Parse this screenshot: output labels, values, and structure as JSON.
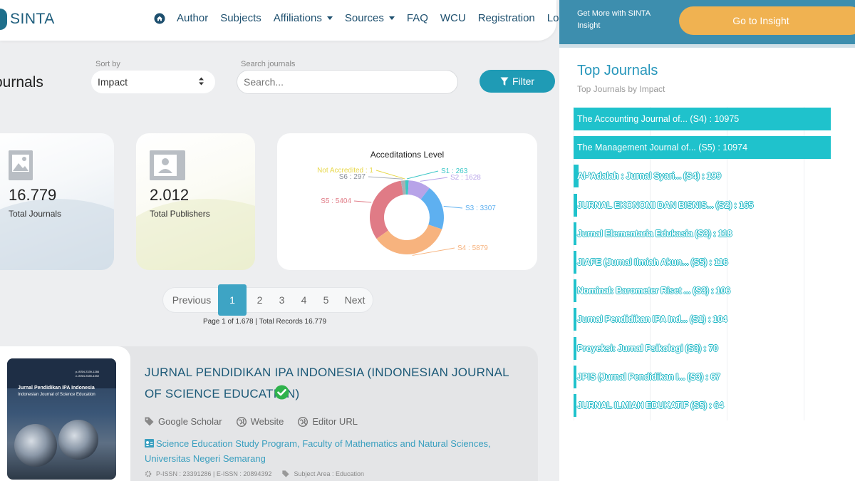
{
  "brand": {
    "name": "SINTA"
  },
  "nav": [
    {
      "label": "Author",
      "dropdown": false
    },
    {
      "label": "Subjects",
      "dropdown": false
    },
    {
      "label": "Affiliations",
      "dropdown": true
    },
    {
      "label": "Sources",
      "dropdown": true
    },
    {
      "label": "FAQ",
      "dropdown": false
    },
    {
      "label": "WCU",
      "dropdown": false
    },
    {
      "label": "Registration",
      "dropdown": false
    },
    {
      "label": "Login",
      "dropdown": false
    }
  ],
  "page": {
    "title": "ournals"
  },
  "sort": {
    "label": "Sort by",
    "value": "Impact"
  },
  "search": {
    "label": "Search journals",
    "placeholder": "Search..."
  },
  "filter": {
    "label": "Filter"
  },
  "stats": [
    {
      "value": "16.779",
      "label": "Total Journals",
      "icon": "image-icon"
    },
    {
      "value": "2.012",
      "label": "Total Publishers",
      "icon": "contact-card-icon"
    }
  ],
  "accreditation_chart": {
    "title": "Acceditations Level",
    "chart_data": {
      "type": "pie",
      "title": "Acceditations Level",
      "slices": [
        {
          "label": "S1",
          "value": 263,
          "color": "#3cc7c7"
        },
        {
          "label": "S2",
          "value": 1628,
          "color": "#b7a3e8"
        },
        {
          "label": "S3",
          "value": 3307,
          "color": "#5eb0f0"
        },
        {
          "label": "S4",
          "value": 5879,
          "color": "#f7b37e"
        },
        {
          "label": "S5",
          "value": 5404,
          "color": "#e07b86"
        },
        {
          "label": "S6",
          "value": 297,
          "color": "#a8aeb6"
        },
        {
          "label": "Not Accredited",
          "value": 1,
          "color": "#e8d84a"
        }
      ]
    }
  },
  "pagination": {
    "previous": "Previous",
    "pages": [
      "1",
      "2",
      "3",
      "4",
      "5"
    ],
    "active": "1",
    "next": "Next",
    "info": "Page 1 of 1.678 | Total Records 16.779"
  },
  "journal": {
    "cover_title": "Jurnal Pendidikan IPA Indonesia",
    "cover_subtitle": "Indonesian Journal of Science Education",
    "cover_issn": "p-ISSN 2339-1286\ne-ISSN 2089-4392",
    "title": "JURNAL PENDIDIKAN IPA INDONESIA (INDONESIAN JOURNAL OF SCIENCE EDUCATION)",
    "links": [
      "Google Scholar",
      "Website",
      "Editor URL"
    ],
    "affiliation": "Science Education Study Program, Faculty of Mathematics and Natural Sciences, Universitas Negeri Semarang",
    "issn": "P-ISSN : 23391286 | E-ISSN : 20894392",
    "subject": "Subject Area : Education"
  },
  "insight": {
    "text": "Get More with SINTA Insight",
    "button": "Go to Insight"
  },
  "top_journals": {
    "title": "Top Journals",
    "subtitle": "Top Journals by Impact",
    "chart_data": {
      "type": "bar",
      "orientation": "horizontal",
      "items": [
        {
          "label": "The Accounting Journal of... (S4) : 10975",
          "value": 10975
        },
        {
          "label": "The Management Journal of... (S5) : 10974",
          "value": 10974
        },
        {
          "label": "Al-'Adalah : Jurnal Syari... (S4) : 199",
          "value": 199
        },
        {
          "label": "JURNAL EKONOMI DAN BISNIS... (S2) : 165",
          "value": 165
        },
        {
          "label": "Jurnal Elementaria Edukasia (S3) : 118",
          "value": 118
        },
        {
          "label": "JIAFE (Jurnal Ilmiah Akun... (S5) : 116",
          "value": 116
        },
        {
          "label": "Nominal: Barometer Riset ... (S3) : 106",
          "value": 106
        },
        {
          "label": "Jurnal Pendidikan IPA Ind... (S1) : 104",
          "value": 104
        },
        {
          "label": "Proyeksi: Jurnal Psikologi (S3) : 70",
          "value": 70
        },
        {
          "label": "JPIS (Jurnal Pendidikan I... (S3) : 67",
          "value": 67
        },
        {
          "label": "JURNAL ILMIAH EDUKATIF (S5) : 64",
          "value": 64
        }
      ]
    }
  },
  "colors": {
    "primary": "#1d5a78",
    "accent": "#1f9bb5",
    "bar": "#1fc2cc",
    "insight": "#f0b251"
  }
}
